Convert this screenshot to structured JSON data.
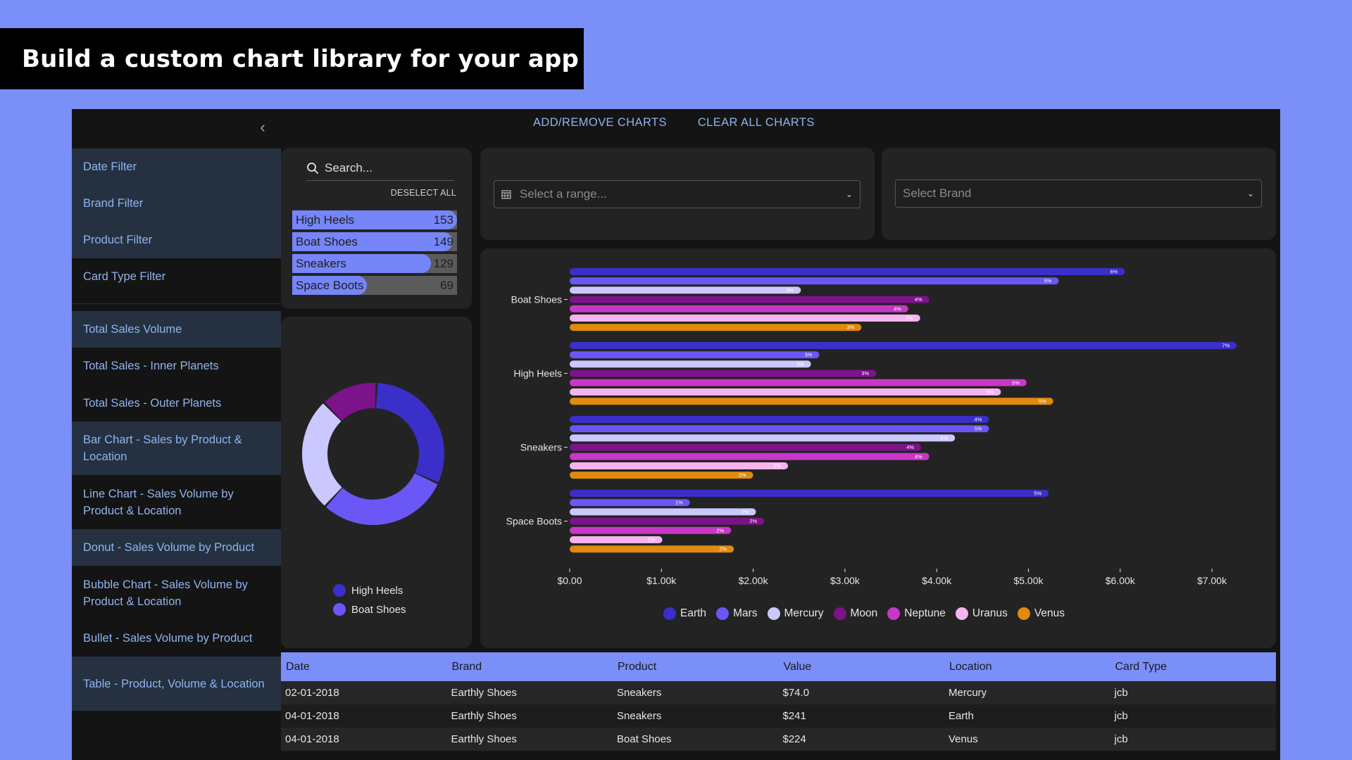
{
  "banner": {
    "text": "Build a custom chart library for your app"
  },
  "sidebar": {
    "collapse_icon": "chevron-left-icon",
    "filters": [
      "Date Filter",
      "Brand Filter",
      "Product Filter",
      "Card Type Filter"
    ],
    "charts": [
      "Total Sales Volume",
      "Total Sales - Inner Planets",
      "Total Sales - Outer Planets",
      "Bar Chart - Sales by Product & Location",
      "Line Chart - Sales Volume by Product & Location",
      "Donut - Sales Volume by Product",
      "Bubble Chart - Sales Volume by Product & Location",
      "Bullet - Sales Volume by Product",
      "Table - Product, Volume & Location"
    ]
  },
  "top_actions": {
    "add_remove": "ADD/REMOVE CHARTS",
    "clear_all": "CLEAR ALL CHARTS"
  },
  "product_filter": {
    "search_placeholder": "Search...",
    "deselect_all": "DESELECT ALL",
    "items": [
      {
        "label": "High Heels",
        "count": 153
      },
      {
        "label": "Boat Shoes",
        "count": 149
      },
      {
        "label": "Sneakers",
        "count": 129
      },
      {
        "label": "Space Boots",
        "count": 69
      }
    ]
  },
  "date_range": {
    "placeholder": "Select a range..."
  },
  "brand_select": {
    "placeholder": "Select Brand"
  },
  "donut": {
    "legend": [
      {
        "label": "High Heels",
        "color": "#3b2fc9"
      },
      {
        "label": "Boat Shoes",
        "color": "#6a57f5"
      }
    ],
    "segments": [
      {
        "product": "High Heels",
        "fraction": 0.31,
        "color": "#3b2fc9"
      },
      {
        "product": "Boat Shoes",
        "fraction": 0.3,
        "color": "#6a57f5"
      },
      {
        "product": "Sneakers",
        "fraction": 0.26,
        "color": "#cbc7ff"
      },
      {
        "product": "Space Boots",
        "fraction": 0.13,
        "color": "#7d138a"
      }
    ]
  },
  "chart_data": {
    "type": "bar",
    "orientation": "horizontal",
    "categories": [
      "Boat Shoes",
      "High Heels",
      "Sneakers",
      "Space Boots"
    ],
    "xlim": [
      0,
      7500
    ],
    "x_ticks": [
      "$0.00",
      "$1.00k",
      "$2.00k",
      "$3.00k",
      "$4.00k",
      "$5.00k",
      "$6.00k",
      "$7.00k"
    ],
    "series": [
      {
        "name": "Earth",
        "color": "#3b2fc9",
        "values": [
          6050,
          7270,
          4570,
          5220
        ],
        "labels": [
          "6%",
          "7%",
          "4%",
          "5%"
        ]
      },
      {
        "name": "Mars",
        "color": "#6a57f5",
        "values": [
          5330,
          2720,
          4570,
          1310
        ],
        "labels": [
          "5%",
          "3%",
          "5%",
          "1%"
        ]
      },
      {
        "name": "Mercury",
        "color": "#cbc7ff",
        "values": [
          2520,
          2630,
          4200,
          2030
        ],
        "labels": [
          "3%",
          "3%",
          "4%",
          "2%"
        ]
      },
      {
        "name": "Moon",
        "color": "#7d138a",
        "values": [
          3920,
          3340,
          3830,
          2120
        ],
        "labels": [
          "4%",
          "3%",
          "4%",
          "2%"
        ]
      },
      {
        "name": "Neptune",
        "color": "#c837c8",
        "values": [
          3690,
          4980,
          3920,
          1760
        ],
        "labels": [
          "4%",
          "5%",
          "4%",
          "2%"
        ]
      },
      {
        "name": "Uranus",
        "color": "#f5b4ee",
        "values": [
          3820,
          4700,
          2380,
          1010
        ],
        "labels": [
          "4%",
          "5%",
          "2%",
          "1%"
        ]
      },
      {
        "name": "Venus",
        "color": "#e08a0e",
        "values": [
          3180,
          5270,
          2000,
          1790
        ],
        "labels": [
          "3%",
          "5%",
          "2%",
          "2%"
        ]
      }
    ],
    "legend_position": "bottom",
    "grid": false
  },
  "table": {
    "headers": [
      "Date",
      "Brand",
      "Product",
      "Value",
      "Location",
      "Card Type"
    ],
    "rows": [
      [
        "02-01-2018",
        "Earthly Shoes",
        "Sneakers",
        "$74.0",
        "Mercury",
        "jcb"
      ],
      [
        "04-01-2018",
        "Earthly Shoes",
        "Sneakers",
        "$241",
        "Earth",
        "jcb"
      ],
      [
        "04-01-2018",
        "Earthly Shoes",
        "Boat Shoes",
        "$224",
        "Venus",
        "jcb"
      ]
    ]
  }
}
